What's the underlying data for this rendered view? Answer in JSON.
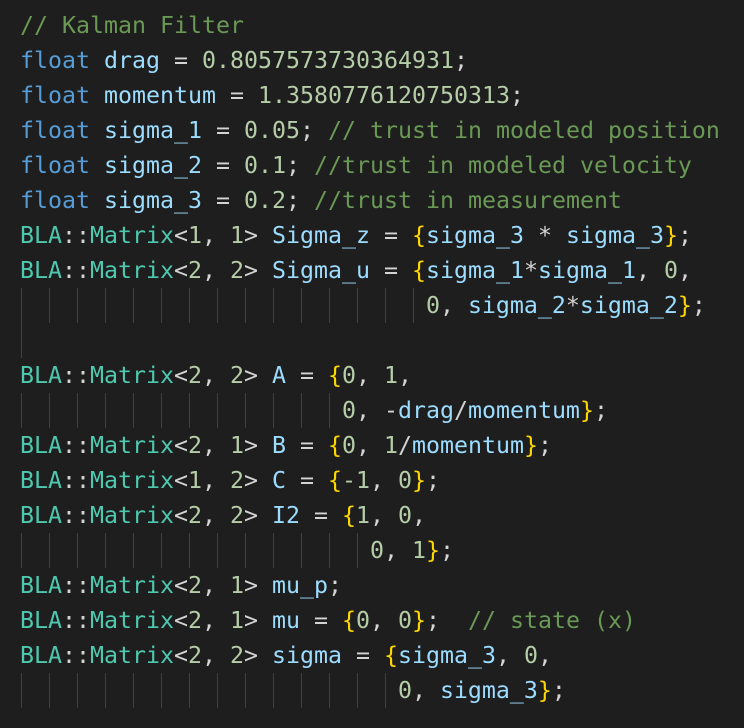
{
  "code": {
    "lines": [
      {
        "tokens": [
          {
            "t": "cm",
            "s": "// Kalman Filter"
          }
        ]
      },
      {
        "tokens": [
          {
            "t": "kw",
            "s": "float"
          },
          {
            "t": "p",
            "s": " "
          },
          {
            "t": "var",
            "s": "drag"
          },
          {
            "t": "p",
            "s": " = "
          },
          {
            "t": "num",
            "s": "0.8057573730364931"
          },
          {
            "t": "p",
            "s": ";"
          }
        ]
      },
      {
        "tokens": [
          {
            "t": "kw",
            "s": "float"
          },
          {
            "t": "p",
            "s": " "
          },
          {
            "t": "var",
            "s": "momentum"
          },
          {
            "t": "p",
            "s": " = "
          },
          {
            "t": "num",
            "s": "1.3580776120750313"
          },
          {
            "t": "p",
            "s": ";"
          }
        ]
      },
      {
        "tokens": [
          {
            "t": "kw",
            "s": "float"
          },
          {
            "t": "p",
            "s": " "
          },
          {
            "t": "var",
            "s": "sigma_1"
          },
          {
            "t": "p",
            "s": " = "
          },
          {
            "t": "num",
            "s": "0.05"
          },
          {
            "t": "p",
            "s": "; "
          },
          {
            "t": "cm",
            "s": "// trust in modeled position"
          }
        ]
      },
      {
        "tokens": [
          {
            "t": "kw",
            "s": "float"
          },
          {
            "t": "p",
            "s": " "
          },
          {
            "t": "var",
            "s": "sigma_2"
          },
          {
            "t": "p",
            "s": " = "
          },
          {
            "t": "num",
            "s": "0.1"
          },
          {
            "t": "p",
            "s": "; "
          },
          {
            "t": "cm",
            "s": "//trust in modeled velocity"
          }
        ]
      },
      {
        "tokens": [
          {
            "t": "kw",
            "s": "float"
          },
          {
            "t": "p",
            "s": " "
          },
          {
            "t": "var",
            "s": "sigma_3"
          },
          {
            "t": "p",
            "s": " = "
          },
          {
            "t": "num",
            "s": "0.2"
          },
          {
            "t": "p",
            "s": "; "
          },
          {
            "t": "cm",
            "s": "//trust in measurement"
          }
        ]
      },
      {
        "tokens": [
          {
            "t": "ty",
            "s": "BLA"
          },
          {
            "t": "p",
            "s": "::"
          },
          {
            "t": "ty",
            "s": "Matrix"
          },
          {
            "t": "p",
            "s": "<"
          },
          {
            "t": "num",
            "s": "1"
          },
          {
            "t": "p",
            "s": ", "
          },
          {
            "t": "num",
            "s": "1"
          },
          {
            "t": "p",
            "s": "> "
          },
          {
            "t": "var",
            "s": "Sigma_z"
          },
          {
            "t": "p",
            "s": " = "
          },
          {
            "t": "br",
            "s": "{"
          },
          {
            "t": "var",
            "s": "sigma_3"
          },
          {
            "t": "p",
            "s": " * "
          },
          {
            "t": "var",
            "s": "sigma_3"
          },
          {
            "t": "br",
            "s": "}"
          },
          {
            "t": "p",
            "s": ";"
          }
        ]
      },
      {
        "tokens": [
          {
            "t": "ty",
            "s": "BLA"
          },
          {
            "t": "p",
            "s": "::"
          },
          {
            "t": "ty",
            "s": "Matrix"
          },
          {
            "t": "p",
            "s": "<"
          },
          {
            "t": "num",
            "s": "2"
          },
          {
            "t": "p",
            "s": ", "
          },
          {
            "t": "num",
            "s": "2"
          },
          {
            "t": "p",
            "s": "> "
          },
          {
            "t": "var",
            "s": "Sigma_u"
          },
          {
            "t": "p",
            "s": " = "
          },
          {
            "t": "br",
            "s": "{"
          },
          {
            "t": "var",
            "s": "sigma_1"
          },
          {
            "t": "p",
            "s": "*"
          },
          {
            "t": "var",
            "s": "sigma_1"
          },
          {
            "t": "p",
            "s": ", "
          },
          {
            "t": "num",
            "s": "0"
          },
          {
            "t": "p",
            "s": ","
          }
        ]
      },
      {
        "tokens": [
          {
            "t": "indent",
            "s": "                             "
          },
          {
            "t": "num",
            "s": "0"
          },
          {
            "t": "p",
            "s": ", "
          },
          {
            "t": "var",
            "s": "sigma_2"
          },
          {
            "t": "p",
            "s": "*"
          },
          {
            "t": "var",
            "s": "sigma_2"
          },
          {
            "t": "br",
            "s": "}"
          },
          {
            "t": "p",
            "s": ";"
          }
        ]
      },
      {
        "tokens": [
          {
            "t": "indent1",
            "s": "  "
          }
        ]
      },
      {
        "tokens": [
          {
            "t": "ty",
            "s": "BLA"
          },
          {
            "t": "p",
            "s": "::"
          },
          {
            "t": "ty",
            "s": "Matrix"
          },
          {
            "t": "p",
            "s": "<"
          },
          {
            "t": "num",
            "s": "2"
          },
          {
            "t": "p",
            "s": ", "
          },
          {
            "t": "num",
            "s": "2"
          },
          {
            "t": "p",
            "s": "> "
          },
          {
            "t": "var",
            "s": "A"
          },
          {
            "t": "p",
            "s": " = "
          },
          {
            "t": "br",
            "s": "{"
          },
          {
            "t": "num",
            "s": "0"
          },
          {
            "t": "p",
            "s": ", "
          },
          {
            "t": "num",
            "s": "1"
          },
          {
            "t": "p",
            "s": ","
          }
        ]
      },
      {
        "tokens": [
          {
            "t": "indent",
            "s": "                       "
          },
          {
            "t": "num",
            "s": "0"
          },
          {
            "t": "p",
            "s": ", -"
          },
          {
            "t": "var",
            "s": "drag"
          },
          {
            "t": "p",
            "s": "/"
          },
          {
            "t": "var",
            "s": "momentum"
          },
          {
            "t": "br",
            "s": "}"
          },
          {
            "t": "p",
            "s": ";"
          }
        ]
      },
      {
        "tokens": [
          {
            "t": "ty",
            "s": "BLA"
          },
          {
            "t": "p",
            "s": "::"
          },
          {
            "t": "ty",
            "s": "Matrix"
          },
          {
            "t": "p",
            "s": "<"
          },
          {
            "t": "num",
            "s": "2"
          },
          {
            "t": "p",
            "s": ", "
          },
          {
            "t": "num",
            "s": "1"
          },
          {
            "t": "p",
            "s": "> "
          },
          {
            "t": "var",
            "s": "B"
          },
          {
            "t": "p",
            "s": " = "
          },
          {
            "t": "br",
            "s": "{"
          },
          {
            "t": "num",
            "s": "0"
          },
          {
            "t": "p",
            "s": ", "
          },
          {
            "t": "num",
            "s": "1"
          },
          {
            "t": "p",
            "s": "/"
          },
          {
            "t": "var",
            "s": "momentum"
          },
          {
            "t": "br",
            "s": "}"
          },
          {
            "t": "p",
            "s": ";"
          }
        ]
      },
      {
        "tokens": [
          {
            "t": "ty",
            "s": "BLA"
          },
          {
            "t": "p",
            "s": "::"
          },
          {
            "t": "ty",
            "s": "Matrix"
          },
          {
            "t": "p",
            "s": "<"
          },
          {
            "t": "num",
            "s": "1"
          },
          {
            "t": "p",
            "s": ", "
          },
          {
            "t": "num",
            "s": "2"
          },
          {
            "t": "p",
            "s": "> "
          },
          {
            "t": "var",
            "s": "C"
          },
          {
            "t": "p",
            "s": " = "
          },
          {
            "t": "br",
            "s": "{"
          },
          {
            "t": "num",
            "s": "-1"
          },
          {
            "t": "p",
            "s": ", "
          },
          {
            "t": "num",
            "s": "0"
          },
          {
            "t": "br",
            "s": "}"
          },
          {
            "t": "p",
            "s": ";"
          }
        ]
      },
      {
        "tokens": [
          {
            "t": "ty",
            "s": "BLA"
          },
          {
            "t": "p",
            "s": "::"
          },
          {
            "t": "ty",
            "s": "Matrix"
          },
          {
            "t": "p",
            "s": "<"
          },
          {
            "t": "num",
            "s": "2"
          },
          {
            "t": "p",
            "s": ", "
          },
          {
            "t": "num",
            "s": "2"
          },
          {
            "t": "p",
            "s": "> "
          },
          {
            "t": "var",
            "s": "I2"
          },
          {
            "t": "p",
            "s": " = "
          },
          {
            "t": "br",
            "s": "{"
          },
          {
            "t": "num",
            "s": "1"
          },
          {
            "t": "p",
            "s": ", "
          },
          {
            "t": "num",
            "s": "0"
          },
          {
            "t": "p",
            "s": ","
          }
        ]
      },
      {
        "tokens": [
          {
            "t": "indent",
            "s": "                         "
          },
          {
            "t": "num",
            "s": "0"
          },
          {
            "t": "p",
            "s": ", "
          },
          {
            "t": "num",
            "s": "1"
          },
          {
            "t": "br",
            "s": "}"
          },
          {
            "t": "p",
            "s": ";"
          }
        ]
      },
      {
        "tokens": [
          {
            "t": "ty",
            "s": "BLA"
          },
          {
            "t": "p",
            "s": "::"
          },
          {
            "t": "ty",
            "s": "Matrix"
          },
          {
            "t": "p",
            "s": "<"
          },
          {
            "t": "num",
            "s": "2"
          },
          {
            "t": "p",
            "s": ", "
          },
          {
            "t": "num",
            "s": "1"
          },
          {
            "t": "p",
            "s": "> "
          },
          {
            "t": "var",
            "s": "mu_p"
          },
          {
            "t": "p",
            "s": ";"
          }
        ]
      },
      {
        "tokens": [
          {
            "t": "ty",
            "s": "BLA"
          },
          {
            "t": "p",
            "s": "::"
          },
          {
            "t": "ty",
            "s": "Matrix"
          },
          {
            "t": "p",
            "s": "<"
          },
          {
            "t": "num",
            "s": "2"
          },
          {
            "t": "p",
            "s": ", "
          },
          {
            "t": "num",
            "s": "1"
          },
          {
            "t": "p",
            "s": "> "
          },
          {
            "t": "var",
            "s": "mu"
          },
          {
            "t": "p",
            "s": " = "
          },
          {
            "t": "br",
            "s": "{"
          },
          {
            "t": "num",
            "s": "0"
          },
          {
            "t": "p",
            "s": ", "
          },
          {
            "t": "num",
            "s": "0"
          },
          {
            "t": "br",
            "s": "}"
          },
          {
            "t": "p",
            "s": ";  "
          },
          {
            "t": "cm",
            "s": "// state (x)"
          }
        ]
      },
      {
        "tokens": [
          {
            "t": "ty",
            "s": "BLA"
          },
          {
            "t": "p",
            "s": "::"
          },
          {
            "t": "ty",
            "s": "Matrix"
          },
          {
            "t": "p",
            "s": "<"
          },
          {
            "t": "num",
            "s": "2"
          },
          {
            "t": "p",
            "s": ", "
          },
          {
            "t": "num",
            "s": "2"
          },
          {
            "t": "p",
            "s": "> "
          },
          {
            "t": "var",
            "s": "sigma"
          },
          {
            "t": "p",
            "s": " = "
          },
          {
            "t": "br",
            "s": "{"
          },
          {
            "t": "var",
            "s": "sigma_3"
          },
          {
            "t": "p",
            "s": ", "
          },
          {
            "t": "num",
            "s": "0"
          },
          {
            "t": "p",
            "s": ","
          }
        ]
      },
      {
        "tokens": [
          {
            "t": "indent",
            "s": "                           "
          },
          {
            "t": "num",
            "s": "0"
          },
          {
            "t": "p",
            "s": ", "
          },
          {
            "t": "var",
            "s": "sigma_3"
          },
          {
            "t": "br",
            "s": "}"
          },
          {
            "t": "p",
            "s": ";"
          }
        ]
      }
    ]
  },
  "colors": {
    "background": "#1e1e1e",
    "keyword": "#569cd6",
    "variable": "#9cdcfe",
    "number": "#b5cea8",
    "comment": "#6a9955",
    "type": "#4ec9b0",
    "brace": "#ffd700",
    "punctuation": "#d4d4d4"
  }
}
